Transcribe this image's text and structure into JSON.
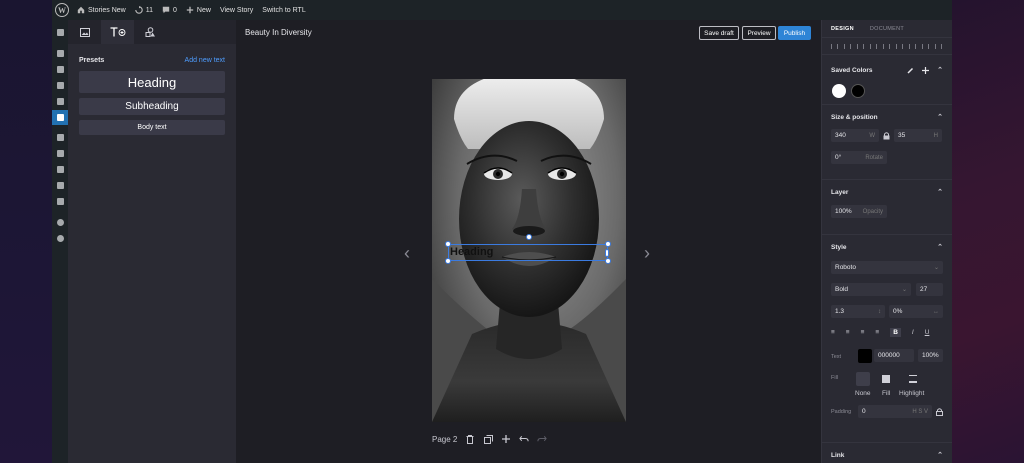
{
  "admin_bar": {
    "site_name": "Stories New",
    "updates_count": "11",
    "comments_count": "0",
    "new_label": "New",
    "view_story": "View Story",
    "switch_rtl": "Switch to RTL"
  },
  "left_panel": {
    "presets_title": "Presets",
    "add_new_text": "Add new text",
    "presets": [
      "Heading",
      "Subheading",
      "Body text"
    ]
  },
  "header": {
    "story_title": "Beauty In Diversity",
    "save_draft": "Save draft",
    "preview": "Preview",
    "publish": "Publish"
  },
  "canvas": {
    "selected_text": "Heading",
    "page_label": "Page 2"
  },
  "right_panel": {
    "tabs": [
      "DESIGN",
      "DOCUMENT"
    ],
    "saved_colors": {
      "title": "Saved Colors",
      "colors": [
        "#ffffff",
        "#000000"
      ]
    },
    "size_position": {
      "title": "Size & position",
      "width": "340",
      "width_suffix": "W",
      "height": "35",
      "height_suffix": "H",
      "rotate": "0°",
      "rotate_label": "Rotate"
    },
    "layer": {
      "title": "Layer",
      "opacity": "100%",
      "opacity_label": "Opacity"
    },
    "style": {
      "title": "Style",
      "font": "Roboto",
      "weight": "Bold",
      "size": "27",
      "line_height": "1.3",
      "letter_spacing": "0%",
      "text_label": "Text",
      "text_color": "000000",
      "text_opacity": "100%",
      "fill_label": "Fill",
      "fill_options": [
        "None",
        "Fill",
        "Highlight"
      ],
      "padding_label": "Padding",
      "padding": "0",
      "padding_hv": "H S V"
    },
    "link": {
      "title": "Link"
    }
  },
  "colors": {
    "accent": "#2e84d6",
    "selection": "#3b7be0",
    "panel": "#2a2a33"
  }
}
